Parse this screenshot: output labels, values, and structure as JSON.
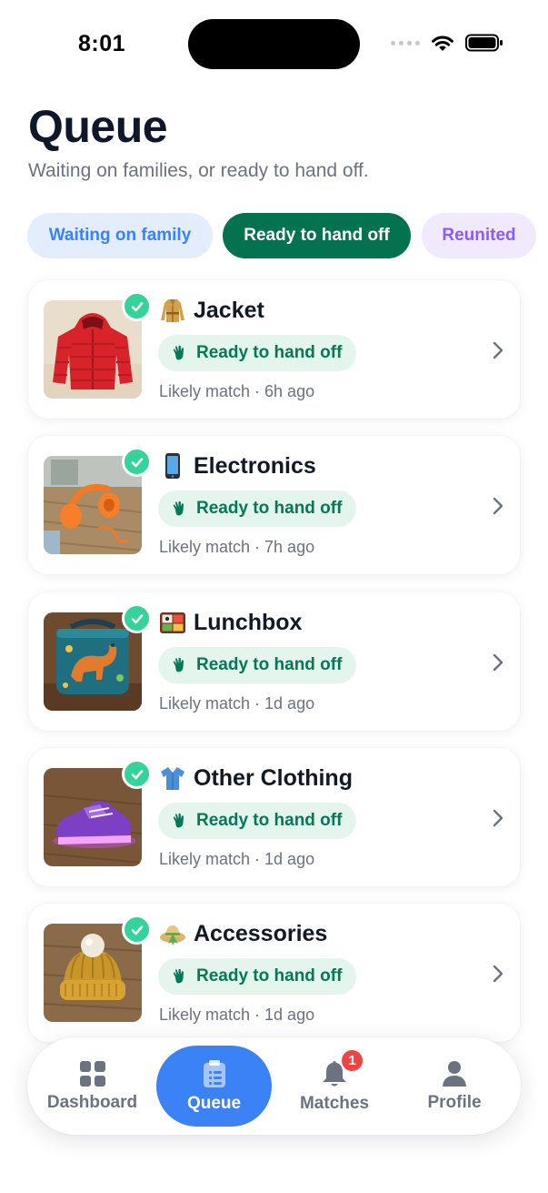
{
  "status_bar": {
    "time": "8:01"
  },
  "header": {
    "title": "Queue",
    "subtitle": "Waiting on families, or ready to hand off."
  },
  "filters": [
    {
      "label": "Waiting on family",
      "active": false
    },
    {
      "label": "Ready to hand off",
      "active": true
    },
    {
      "label": "Reunited",
      "active": false
    }
  ],
  "items": [
    {
      "category": "Jacket",
      "category_icon": "coat-emoji",
      "status": "Ready to hand off",
      "meta": "Likely match · 6h ago",
      "photo": "red puffer jacket"
    },
    {
      "category": "Electronics",
      "category_icon": "mobile-phone-emoji",
      "status": "Ready to hand off",
      "meta": "Likely match · 7h ago",
      "photo": "orange headphones"
    },
    {
      "category": "Lunchbox",
      "category_icon": "bento-box-emoji",
      "status": "Ready to hand off",
      "meta": "Likely match · 1d ago",
      "photo": "dinosaur lunchbox"
    },
    {
      "category": "Other Clothing",
      "category_icon": "shirt-emoji",
      "status": "Ready to hand off",
      "meta": "Likely match · 1d ago",
      "photo": "purple light-up sneaker"
    },
    {
      "category": "Accessories",
      "category_icon": "hat-emoji",
      "status": "Ready to hand off",
      "meta": "Likely match · 1d ago",
      "photo": "mustard knit beanie"
    }
  ],
  "tab_bar": {
    "tabs": [
      {
        "label": "Dashboard",
        "icon": "grid-icon",
        "active": false
      },
      {
        "label": "Queue",
        "icon": "clipboard-icon",
        "active": true
      },
      {
        "label": "Matches",
        "icon": "bell-icon",
        "active": false,
        "badge": "1"
      },
      {
        "label": "Profile",
        "icon": "person-icon",
        "active": false
      }
    ]
  },
  "colors": {
    "accent_blue": "#3b82f6",
    "ready_green": "#04724f",
    "ready_pill_bg": "#e3f5ec",
    "check_green": "#34d399",
    "reunited_purple": "#8b5cf6",
    "badge_red": "#ef4444"
  }
}
